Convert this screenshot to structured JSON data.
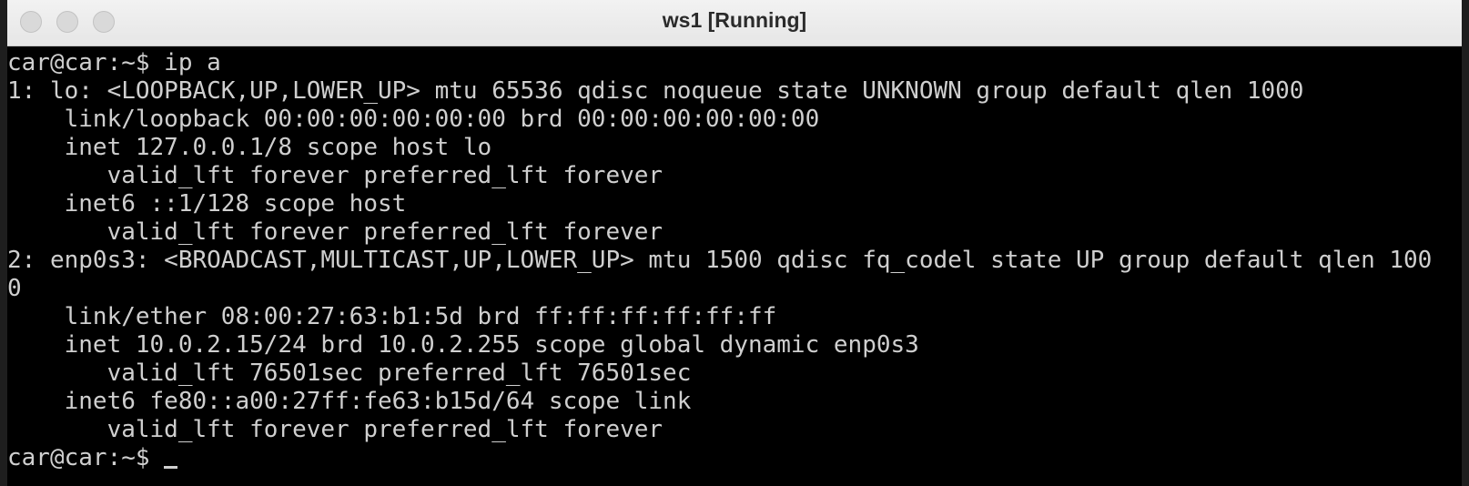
{
  "window": {
    "title": "ws1 [Running]"
  },
  "terminal": {
    "lines": [
      "car@car:~$ ip a",
      "1: lo: <LOOPBACK,UP,LOWER_UP> mtu 65536 qdisc noqueue state UNKNOWN group default qlen 1000",
      "    link/loopback 00:00:00:00:00:00 brd 00:00:00:00:00:00",
      "    inet 127.0.0.1/8 scope host lo",
      "       valid_lft forever preferred_lft forever",
      "    inet6 ::1/128 scope host",
      "       valid_lft forever preferred_lft forever",
      "2: enp0s3: <BROADCAST,MULTICAST,UP,LOWER_UP> mtu 1500 qdisc fq_codel state UP group default qlen 100",
      "0",
      "    link/ether 08:00:27:63:b1:5d brd ff:ff:ff:ff:ff:ff",
      "    inet 10.0.2.15/24 brd 10.0.2.255 scope global dynamic enp0s3",
      "       valid_lft 76501sec preferred_lft 76501sec",
      "    inet6 fe80::a00:27ff:fe63:b15d/64 scope link",
      "       valid_lft forever preferred_lft forever"
    ],
    "prompt": "car@car:~$ "
  }
}
